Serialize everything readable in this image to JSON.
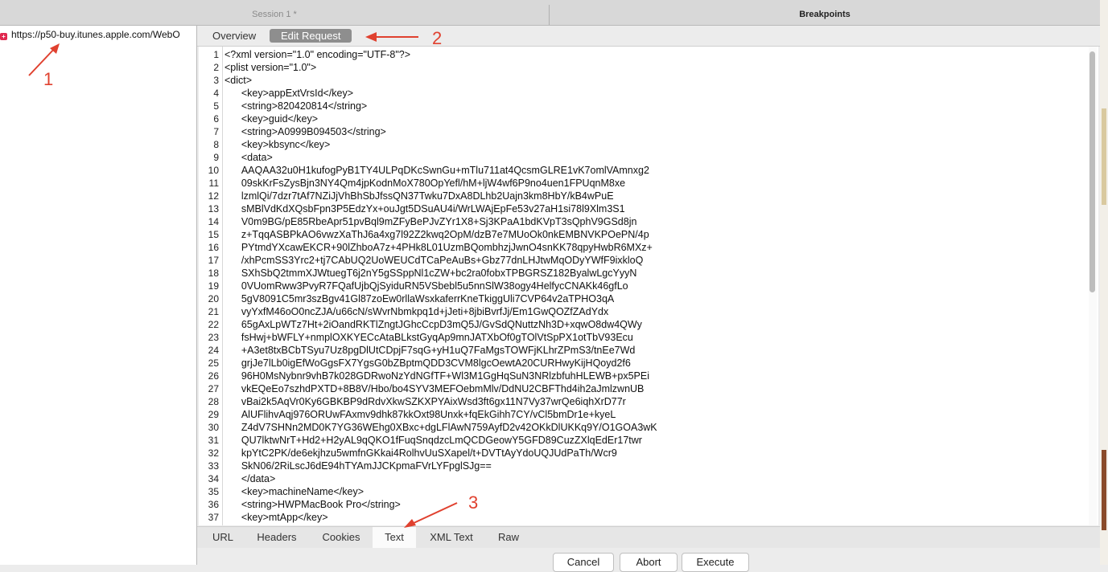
{
  "top_tabs": {
    "session": "Session 1 *",
    "breakpoints": "Breakpoints"
  },
  "left_pane": {
    "request_url": "https://p50-buy.itunes.apple.com/WebO"
  },
  "sub_tabs": [
    "Overview",
    "Edit Request"
  ],
  "editor": {
    "lines": [
      "<?xml version=\"1.0\" encoding=\"UTF-8\"?>",
      "<plist version=\"1.0\">",
      "<dict>",
      "\t<key>appExtVrsId</key>",
      "\t<string>820420814</string>",
      "\t<key>guid</key>",
      "\t<string>A0999B094503</string>",
      "\t<key>kbsync</key>",
      "\t<data>",
      "\tAAQAA32u0H1kufogPyB1TY4ULPqDKcSwnGu+mTlu711at4QcsmGLRE1vK7omlVAmnxg2",
      "\t09skKrFsZysBjn3NY4Qm4jpKodnMoX780OpYefl/hM+ljW4wf6P9no4uen1FPUqnM8xe",
      "\tlzmlQi/7dzr7tAf7NZiJjVhBhSbJfssQN37Twku7DxA8DLhb2Uajn3km8HbY/kB4wPuE",
      "\tsMBlVdKdXQsbFpn3P5EdzYx+ouJgt5DSuAU4i/WrLWAjEpFe53v27aH1si78l9Xlm3S1",
      "\tV0m9BG/pE85RbeApr51pvBql9mZFyBePJvZYr1X8+Sj3KPaA1bdKVpT3sQphV9GSd8jn",
      "\tz+TqqASBPkAO6vwzXaThJ6a4xg7l92Z2kwq2OpM/dzB7e7MUoOk0nkEMBNVKPOePN/4p",
      "\tPYtmdYXcawEKCR+90lZhboA7z+4PHk8L01UzmBQombhzjJwnO4snKK78qpyHwbR6MXz+",
      "\t/xhPcmSS3Yrc2+tj7CAbUQ2UoWEUCdTCaPeAuBs+Gbz77dnLHJtwMqODyYWfF9ixkloQ",
      "\tSXhSbQ2tmmXJWtuegT6j2nY5gSSppNl1cZW+bc2ra0fobxTPBGRSZ182ByalwLgcYyyN",
      "\t0VUomRww3PvyR7FQafUjbQjSyiduRN5VSbebl5u5nnSlW38ogy4HelfycCNAKk46gfLo",
      "\t5gV8091C5mr3szBgv41Gl87zoEw0rllaWsxkaferrKneTkiggUli7CVP64v2aTPHO3qA",
      "\tvyYxfM46oO0ncZJA/u66cN/sWvrNbmkpq1d+jJeti+8jbiBvrfJj/Em1GwQOZfZAdYdx",
      "\t65gAxLpWTz7Ht+2iOandRKTlZngtJGhcCcpD3mQ5J/GvSdQNuttzNh3D+xqwO8dw4QWy",
      "\tfsHwj+bWFLY+nmplOXKYECcAtaBLkstGyqAp9mnJATXbOf0gTOlVtSpPX1otTbV93Ecu",
      "\t+A3et8txBCbTSyu7Uz8pgDlUtCDpjF7sqG+yH1uQ7FaMgsTOWFjKLhrZPmS3/tnEe7Wd",
      "\tgrjJe7lLb0igEfWoGgsFX7YgsG0bZBptmQDD3CVM8lgcOewtA20CURHwyKijHQoyd2f6",
      "\t96H0MsNybnr9vhB7k028GDRwoNzYdNGfTF+Wl3M1GgHqSuN3NRlzbfuhHLEWB+px5PEi",
      "\tvkEQeEo7szhdPXTD+8B8V/Hbo/bo4SYV3MEFOebmMlv/DdNU2CBFThd4ih2aJmlzwnUB",
      "\tvBai2k5AqVr0Ky6GBKBP9dRdvXkwSZKXPYAixWsd3ft6gx11N7Vy37wrQe6iqhXrD77r",
      "\tAlUFlihvAqj976ORUwFAxmv9dhk87kkOxt98Unxk+fqEkGihh7CY/vCl5bmDr1e+kyeL",
      "\tZ4dV7SHNn2MD0K7YG36WEhg0XBxc+dgLFlAwN759AyfD2v42OKkDlUKKq9Y/O1GOA3wK",
      "\tQU7lktwNrT+Hd2+H2yAL9qQKO1fFuqSnqdzcLmQCDGeowY5GFD89CuzZXlqEdEr17twr",
      "\tkpYtC2PK/de6ekjhzu5wmfnGKkai4RolhvUuSXapel/t+DVTtAyYdoUQJUdPaTh/Wcr9",
      "\tSkN06/2RiLscJ6dE94hTYAmJJCKpmaFVrLYFpglSJg==",
      "\t</data>",
      "\t<key>machineName</key>",
      "\t<string>HWPMacBook Pro</string>",
      "\t<key>mtApp</key>"
    ]
  },
  "bottom_tabs": [
    "URL",
    "Headers",
    "Cookies",
    "Text",
    "XML Text",
    "Raw"
  ],
  "buttons": {
    "cancel": "Cancel",
    "abort": "Abort",
    "execute": "Execute"
  },
  "annotations": [
    "1",
    "2",
    "3"
  ],
  "colors": {
    "annotation": "#e0412f",
    "selected_tab": "#8e8e8e"
  }
}
